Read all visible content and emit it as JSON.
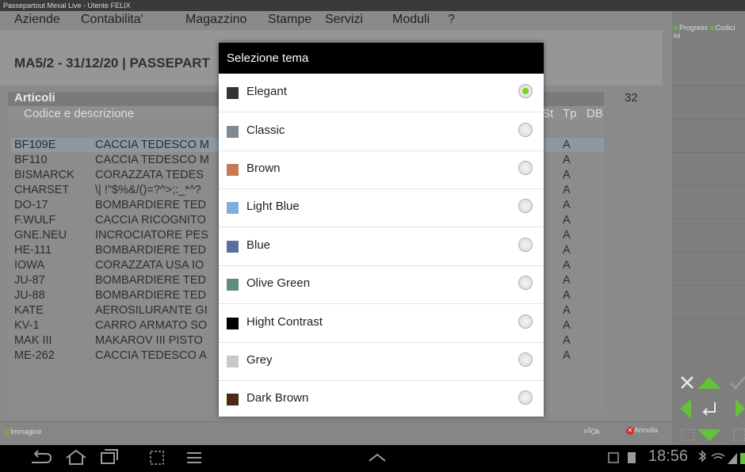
{
  "window_title": "Passepartout Mexal Live - Utente FELIX",
  "menu": [
    "Aziende",
    "Contabilita'",
    "Magazzino",
    "Stampe",
    "Servizi",
    "Moduli",
    "?"
  ],
  "page_title": "MA5/2 - 31/12/20 | PASSEPART",
  "grid": {
    "title": "Articoli",
    "count": "32",
    "columns": {
      "code": "Codice e descrizione",
      "st": "St",
      "tp": "Tp",
      "db": "DB"
    },
    "rows": [
      {
        "code": "BF109E",
        "desc": "CACCIA TEDESCO M",
        "tp": "A"
      },
      {
        "code": "BF110",
        "desc": "CACCIA TEDESCO M",
        "tp": "A"
      },
      {
        "code": "BISMARCK",
        "desc": "CORAZZATA TEDES",
        "tp": "A"
      },
      {
        "code": "CHARSET",
        "desc": "\\| !\"$%&/()=?^>;:_*^?",
        "tp": "A"
      },
      {
        "code": "DO-17",
        "desc": "BOMBARDIERE TED",
        "tp": "A"
      },
      {
        "code": "F.WULF",
        "desc": "CACCIA RICOGNITO",
        "tp": "A"
      },
      {
        "code": "GNE.NEU",
        "desc": "INCROCIATORE PES",
        "tp": "A"
      },
      {
        "code": "HE-111",
        "desc": "BOMBARDIERE TED",
        "tp": "A"
      },
      {
        "code": "IOWA",
        "desc": "CORAZZATA USA IO",
        "tp": "A"
      },
      {
        "code": "JU-87",
        "desc": "BOMBARDIERE TED",
        "tp": "A"
      },
      {
        "code": "JU-88",
        "desc": "BOMBARDIERE TED",
        "tp": "A"
      },
      {
        "code": "KATE",
        "desc": "AEROSILURANTE GI",
        "tp": "A"
      },
      {
        "code": "KV-1",
        "desc": "CARRO ARMATO SO",
        "tp": "A"
      },
      {
        "code": "MAK III",
        "desc": "MAKAROV III PISTO",
        "tp": "A"
      },
      {
        "code": "ME-262",
        "desc": "CACCIA TEDESCO A",
        "tp": "A"
      }
    ]
  },
  "right_panel": {
    "legend1": "Progress",
    "legend2": "Codici",
    "legend3": "ivi"
  },
  "function_bar": {
    "immagine": "Immagine",
    "ok": "Ok",
    "annulla": "Annulla"
  },
  "status_bar": {
    "clock": "18:56"
  },
  "dialog": {
    "title": "Selezione tema",
    "selected": "Elegant",
    "options": [
      {
        "label": "Elegant",
        "color": "#333333"
      },
      {
        "label": "Classic",
        "color": "#7d8b8f"
      },
      {
        "label": "Brown",
        "color": "#c87a56"
      },
      {
        "label": "Light Blue",
        "color": "#7fb0dc"
      },
      {
        "label": "Blue",
        "color": "#5a6fa0"
      },
      {
        "label": "Olive Green",
        "color": "#5e8d7c"
      },
      {
        "label": "Hight Contrast",
        "color": "#000000"
      },
      {
        "label": "Grey",
        "color": "#c8c8c8"
      },
      {
        "label": "Dark Brown",
        "color": "#4a2a14"
      }
    ]
  }
}
